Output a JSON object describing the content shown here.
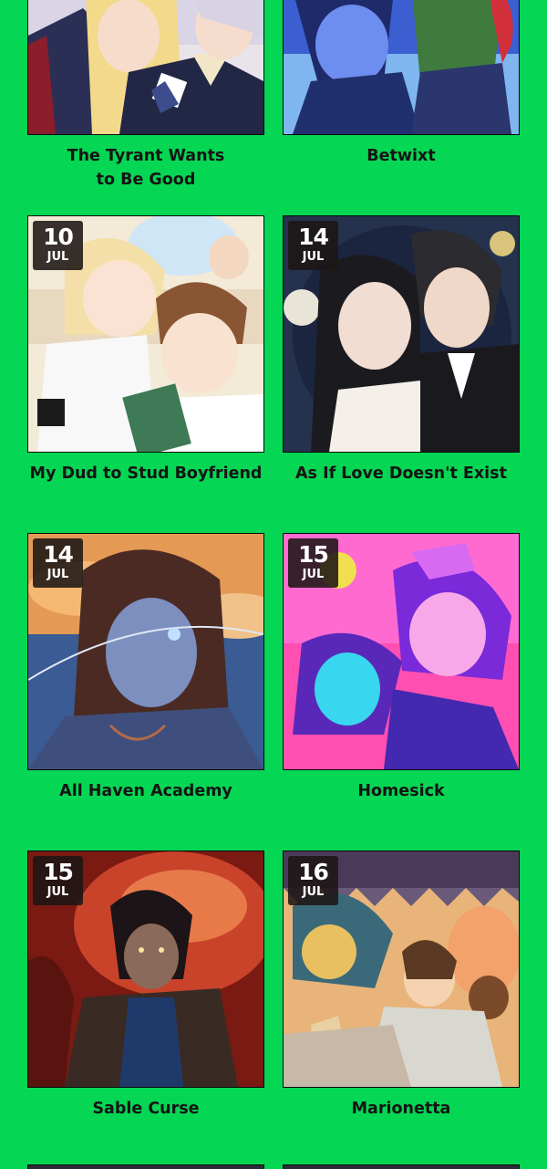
{
  "series": [
    {
      "title": "The Tyrant Wants to Be Good",
      "title_lines": [
        "The Tyrant Wants",
        "to Be Good"
      ],
      "day": "",
      "month": "",
      "thumb": "royal-couple-art"
    },
    {
      "title": "Betwixt",
      "day": "",
      "month": "",
      "thumb": "blue-boy-art"
    },
    {
      "title": "My Dud to Stud Boyfriend",
      "day": "10",
      "month": "JUL",
      "thumb": "school-couple-art"
    },
    {
      "title": "As If Love Doesn't Exist",
      "day": "14",
      "month": "JUL",
      "thumb": "dark-couple-art"
    },
    {
      "title": "All Haven Academy",
      "day": "14",
      "month": "JUL",
      "thumb": "cracked-face-art"
    },
    {
      "title": "Homesick",
      "day": "15",
      "month": "JUL",
      "thumb": "neon-girls-art"
    },
    {
      "title": "Sable Curse",
      "day": "15",
      "month": "JUL",
      "thumb": "red-eyes-art"
    },
    {
      "title": "Marionetta",
      "day": "16",
      "month": "JUL",
      "thumb": "circus-art"
    }
  ],
  "colors": {
    "page_background": "#05d654",
    "badge_background": "#1c1614",
    "title_text": "#141414"
  }
}
